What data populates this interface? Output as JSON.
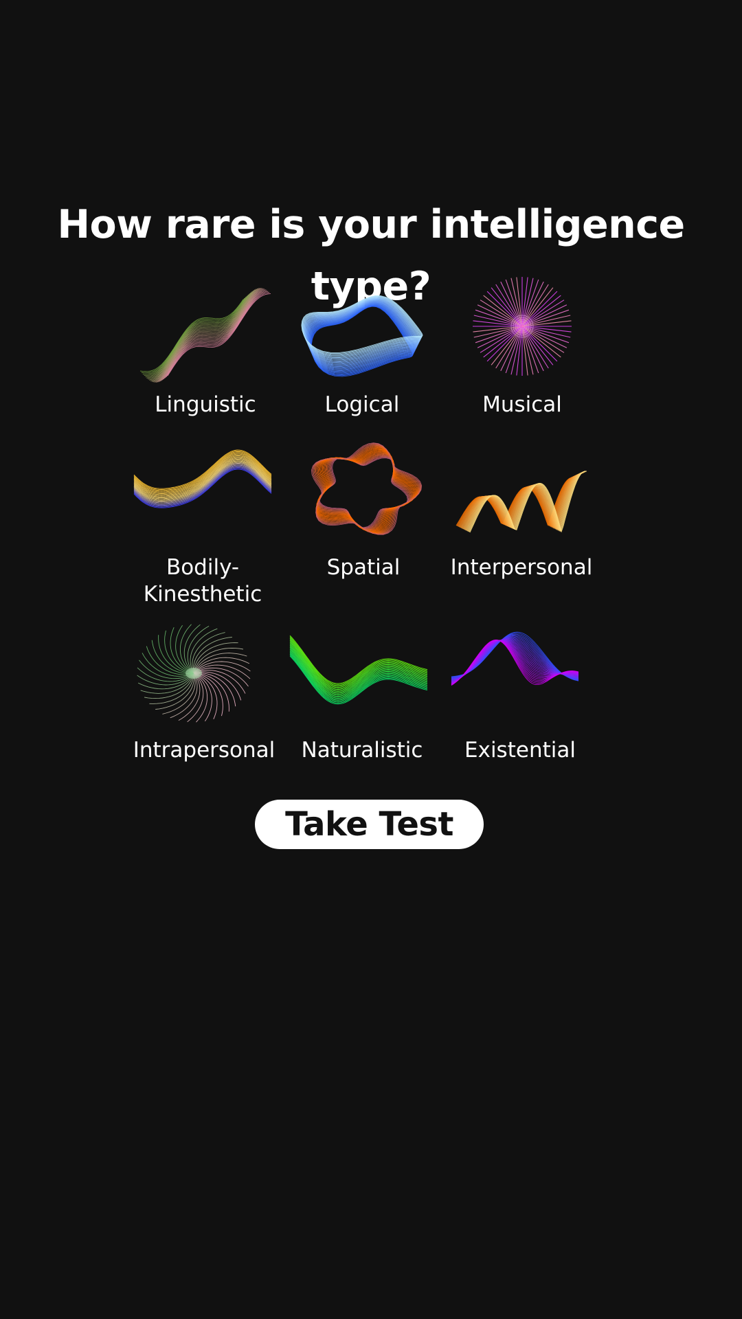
{
  "title": "How rare is your intelligence type?",
  "types": [
    {
      "label": "Linguistic",
      "icon": "linguistic-wave-icon",
      "colors": [
        "#7cb342",
        "#c5e1a5",
        "#f48fb1"
      ]
    },
    {
      "label": "Logical",
      "icon": "logical-wave-icon",
      "colors": [
        "#2962ff",
        "#448aff",
        "#b3e5fc"
      ]
    },
    {
      "label": "Musical",
      "icon": "musical-starburst-icon",
      "colors": [
        "#e040fb",
        "#f48fb1",
        "#ce93d8"
      ]
    },
    {
      "label": "Bodily-Kinesthetic",
      "icon": "bodily-kinesthetic-wave-icon",
      "colors": [
        "#fbc02d",
        "#ffe082",
        "#3d3dff"
      ]
    },
    {
      "label": "Spatial",
      "icon": "spatial-ring-icon",
      "colors": [
        "#7c4dff",
        "#d500f9",
        "#ff6d00"
      ]
    },
    {
      "label": "Interpersonal",
      "icon": "interpersonal-wave-icon",
      "colors": [
        "#ef6c00",
        "#ffb74d",
        "#ffe082"
      ]
    },
    {
      "label": "Intrapersonal",
      "icon": "intrapersonal-burst-icon",
      "colors": [
        "#a5d6a7",
        "#66bb6a",
        "#f8bbd0"
      ]
    },
    {
      "label": "Naturalistic",
      "icon": "naturalistic-ribbon-icon",
      "colors": [
        "#76ff03",
        "#64dd17",
        "#00e676"
      ]
    },
    {
      "label": "Existential",
      "icon": "existential-wave-icon",
      "colors": [
        "#304ffe",
        "#7c4dff",
        "#d500f9"
      ]
    }
  ],
  "button": {
    "label": "Take Test"
  },
  "theme": {
    "background": "#111111",
    "text": "#ffffff",
    "button_bg": "#ffffff",
    "button_text": "#111111"
  }
}
